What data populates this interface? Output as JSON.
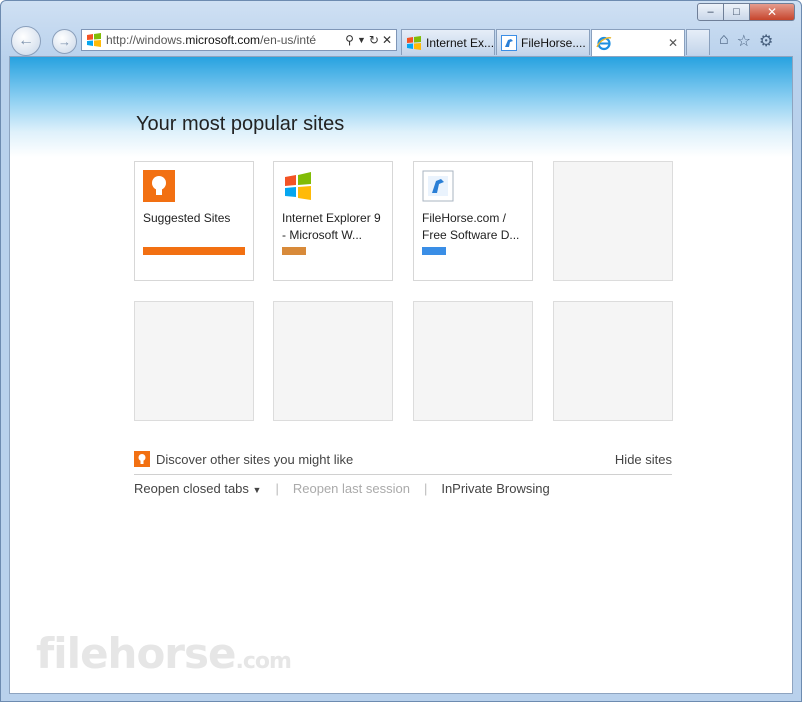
{
  "browser": {
    "address_url_prefix": "http://windows.",
    "address_url_domain": "microsoft.com",
    "address_url_rest": "/en-us/inté",
    "tabs": [
      {
        "label": "Internet Ex...",
        "icon": "windows-flag-icon"
      },
      {
        "label": "FileHorse....",
        "icon": "filehorse-icon"
      },
      {
        "label": "",
        "icon": "ie-icon",
        "active": true
      }
    ],
    "window_controls": {
      "minimize": "–",
      "maximize": "□",
      "close": "✕"
    }
  },
  "page": {
    "heading": "Your most popular sites",
    "tiles": [
      {
        "label": "Suggested Sites",
        "icon": "lightbulb-icon",
        "bar_color": "#f27012"
      },
      {
        "label": "Internet Explorer 9 - Microsoft W...",
        "icon": "windows-flag-icon",
        "bar_color": "#d88a3a"
      },
      {
        "label": "FileHorse.com / Free Software D...",
        "icon": "filehorse-icon",
        "bar_color": "#3a8ee6"
      },
      {
        "label": ""
      },
      {
        "label": ""
      },
      {
        "label": ""
      },
      {
        "label": ""
      },
      {
        "label": ""
      }
    ],
    "discover_text": "Discover other sites you might like",
    "hide_sites": "Hide sites",
    "reopen_closed_tabs": "Reopen closed tabs",
    "reopen_last_session": "Reopen last session",
    "inprivate": "InPrivate Browsing",
    "separator": "|"
  },
  "watermark": {
    "main": "filehorse",
    "suffix": ".com"
  },
  "colors": {
    "accent_orange": "#f27012",
    "header_blue": "#27a2e0"
  }
}
